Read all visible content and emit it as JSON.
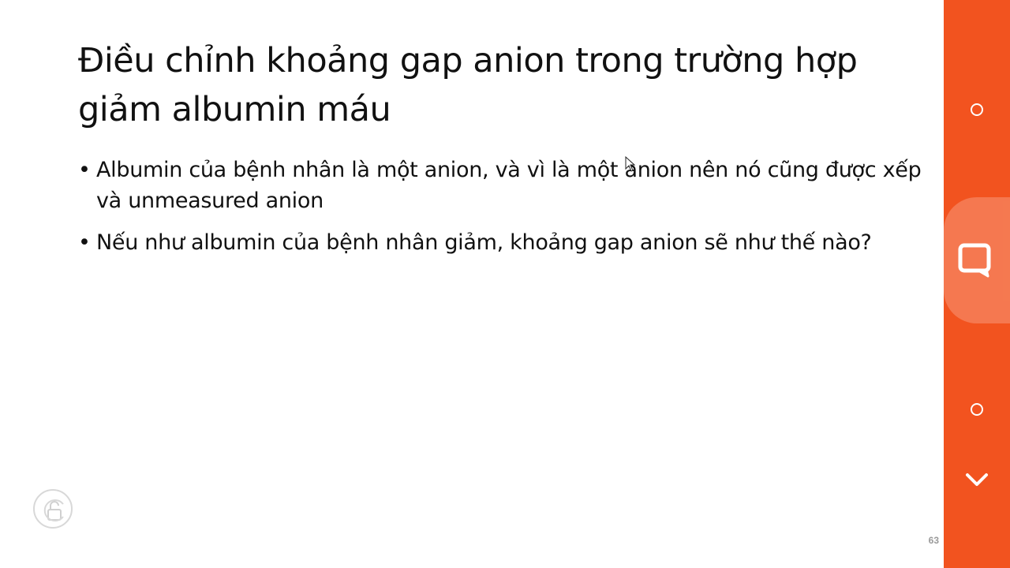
{
  "slide": {
    "title": "Điều chỉnh khoảng gap anion trong trường hợp giảm albumin máu",
    "bullets": [
      "Albumin của bệnh nhân là một anion, và vì là một anion nên nó cũng được xếp và unmeasured anion",
      "Nếu như albumin của bệnh nhân giảm, khoảng gap anion sẽ như thế nào?"
    ],
    "bullet_symbol": "•",
    "page_number": "63"
  },
  "overlay": {
    "lock_icon": "lock-open-icon",
    "cursor_icon": "mouse-cursor-icon"
  },
  "side_panel": {
    "color": "#f2531f",
    "icons": [
      "circle-icon",
      "chat-bubble-icon",
      "circle-icon",
      "chevron-down-icon"
    ]
  }
}
